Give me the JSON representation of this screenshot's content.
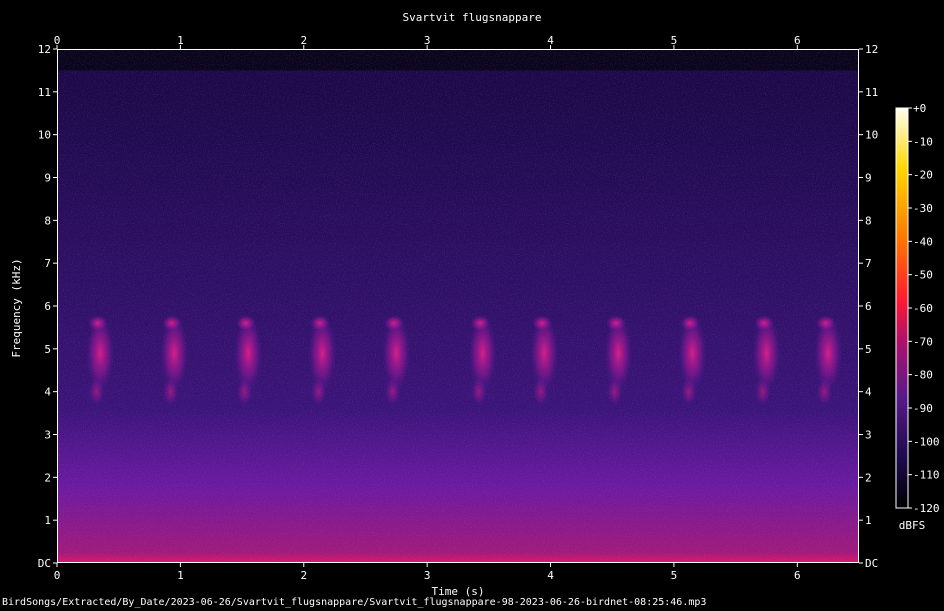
{
  "chart_data": {
    "type": "heatmap",
    "title": "Svartvit flugsnappare",
    "xlabel": "Time (s)",
    "ylabel": "Frequency (kHz)",
    "x_range": [
      0,
      6.5
    ],
    "y_range": [
      0,
      12
    ],
    "x_ticks": [
      "0",
      "1",
      "2",
      "3",
      "4",
      "5",
      "6"
    ],
    "y_ticks": [
      "DC",
      "1",
      "2",
      "3",
      "4",
      "5",
      "6",
      "7",
      "8",
      "9",
      "10",
      "11",
      "12"
    ],
    "colorbar": {
      "label": "dBFS",
      "range": [
        -120,
        0
      ],
      "ticks": [
        "+0",
        "-10",
        "-20",
        "-30",
        "-40",
        "-50",
        "-60",
        "-70",
        "-80",
        "-90",
        "-100",
        "-110",
        "-120"
      ],
      "colors": [
        "#000000",
        "#1a0a4a",
        "#5a1a8a",
        "#b0106a",
        "#ff1a30",
        "#ff7a00",
        "#ffd800",
        "#fffff0"
      ]
    },
    "song_bursts_s": [
      0.3,
      0.9,
      1.5,
      2.1,
      2.7,
      3.4,
      3.9,
      4.5,
      5.1,
      5.7,
      6.2
    ]
  },
  "footer": {
    "path": "BirdSongs/Extracted/By_Date/2023-06-26/Svartvit_flugsnappare/Svartvit_flugsnappare-98-2023-06-26-birdnet-08:25:46.mp3"
  }
}
